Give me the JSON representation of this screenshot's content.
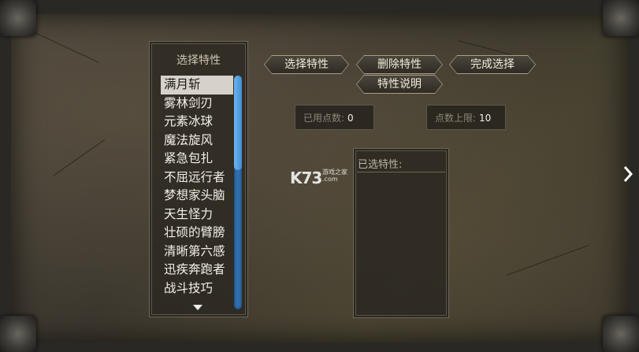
{
  "traits_panel": {
    "title": "选择特性",
    "items": [
      {
        "label": "满月斩",
        "selected": true
      },
      {
        "label": "雾林剑刃",
        "selected": false
      },
      {
        "label": "元素冰球",
        "selected": false
      },
      {
        "label": "魔法旋风",
        "selected": false
      },
      {
        "label": "紧急包扎",
        "selected": false
      },
      {
        "label": "不屈远行者",
        "selected": false
      },
      {
        "label": "梦想家头脑",
        "selected": false
      },
      {
        "label": "天生怪力",
        "selected": false
      },
      {
        "label": "壮硕的臂膀",
        "selected": false
      },
      {
        "label": "清晰第六感",
        "selected": false
      },
      {
        "label": "迅疾奔跑者",
        "selected": false
      },
      {
        "label": "战斗技巧",
        "selected": false
      }
    ]
  },
  "buttons": {
    "select": "选择特性",
    "delete": "删除特性",
    "finish": "完成选择",
    "description": "特性说明"
  },
  "points": {
    "used_label": "已用点数:",
    "used_value": "0",
    "limit_label": "点数上限:",
    "limit_value": "10"
  },
  "selected_panel": {
    "title": "已选特性:"
  },
  "watermark": {
    "logo": "K73",
    "sub1": "游戏之家",
    "sub2": ".com"
  },
  "colors": {
    "scrollbar": "#3e8fd6",
    "selected_row": "#d6d2c9"
  }
}
